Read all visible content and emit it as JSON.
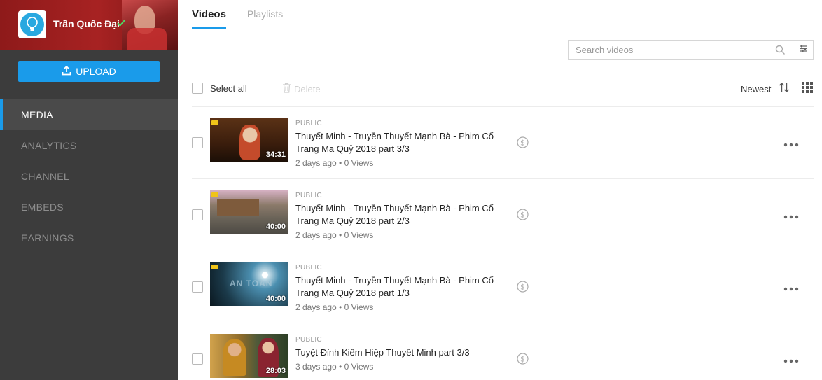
{
  "profile": {
    "name": "Trần Quốc Đại",
    "verified": true
  },
  "sidebar": {
    "upload_label": "UPLOAD",
    "items": [
      {
        "label": "MEDIA",
        "active": true
      },
      {
        "label": "ANALYTICS",
        "active": false
      },
      {
        "label": "CHANNEL",
        "active": false
      },
      {
        "label": "EMBEDS",
        "active": false
      },
      {
        "label": "EARNINGS",
        "active": false
      }
    ]
  },
  "tabs": [
    {
      "label": "Videos",
      "active": true
    },
    {
      "label": "Playlists",
      "active": false
    }
  ],
  "search": {
    "placeholder": "Search videos",
    "value": ""
  },
  "toolbar": {
    "select_all_label": "Select all",
    "delete_label": "Delete",
    "sort_label": "Newest"
  },
  "videos": [
    {
      "visibility": "PUBLIC",
      "title": "Thuyết Minh - Truyền Thuyết Mạnh Bà - Phim Cổ Trang Ma Quỷ 2018 part 3/3",
      "stats": "2 days ago • 0 Views",
      "duration": "34:31"
    },
    {
      "visibility": "PUBLIC",
      "title": "Thuyết Minh - Truyền Thuyết Mạnh Bà - Phim Cổ Trang Ma Quỷ 2018 part 2/3",
      "stats": "2 days ago • 0 Views",
      "duration": "40:00"
    },
    {
      "visibility": "PUBLIC",
      "title": "Thuyết Minh - Truyền Thuyết Mạnh Bà - Phim Cổ Trang Ma Quỷ 2018 part 1/3",
      "stats": "2 days ago • 0 Views",
      "duration": "40:00",
      "thumb_text": "AN TOAN"
    },
    {
      "visibility": "PUBLIC",
      "title": "Tuyệt Đỉnh Kiếm Hiệp Thuyết Minh part 3/3",
      "stats": "3 days ago • 0 Views",
      "duration": "28:03"
    }
  ],
  "colors": {
    "accent": "#1a9bea",
    "sidebar_bg": "#3c3c3c",
    "profile_bg": "#a72222",
    "verified": "#4cd964"
  },
  "icons": {
    "verified": "check-icon",
    "upload": "upload-icon",
    "search": "search-icon",
    "filter": "sliders-icon",
    "delete": "trash-icon",
    "sort": "sort-arrows-icon",
    "grid": "grid-icon",
    "monetization": "dollar-circle-icon",
    "more": "more-dots-icon"
  }
}
